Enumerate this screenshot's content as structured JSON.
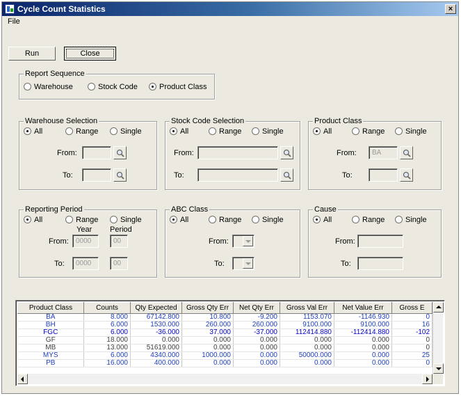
{
  "window": {
    "title": "Cycle Count Statistics",
    "close_glyph": "×"
  },
  "menu": {
    "file": "File"
  },
  "toolbar": {
    "run": "Run",
    "close": "Close"
  },
  "report_sequence": {
    "label": "Report Sequence",
    "options": [
      "Warehouse",
      "Stock Code",
      "Product Class"
    ],
    "selected": "Product Class"
  },
  "warehouse_selection": {
    "label": "Warehouse Selection",
    "options": [
      "All",
      "Range",
      "Single"
    ],
    "selected": "All",
    "from_label": "From:",
    "to_label": "To:",
    "from_value": "",
    "to_value": ""
  },
  "stock_code_selection": {
    "label": "Stock Code Selection",
    "options": [
      "All",
      "Range",
      "Single"
    ],
    "selected": "All",
    "from_label": "From:",
    "to_label": "To:",
    "from_value": "",
    "to_value": ""
  },
  "product_class": {
    "label": "Product Class",
    "options": [
      "All",
      "Range",
      "Single"
    ],
    "selected": "All",
    "from_label": "From:",
    "to_label": "To:",
    "from_value": "BA",
    "to_value": ""
  },
  "reporting_period": {
    "label": "Reporting Period",
    "options": [
      "All",
      "Range",
      "Single"
    ],
    "selected": "All",
    "year_label": "Year",
    "period_label": "Period",
    "from_label": "From:",
    "to_label": "To:",
    "from_year": "0000",
    "from_period": "00",
    "to_year": "0000",
    "to_period": "00"
  },
  "abc_class": {
    "label": "ABC Class",
    "options": [
      "All",
      "Range",
      "Single"
    ],
    "selected": "All",
    "from_label": "From:",
    "to_label": "To:"
  },
  "cause": {
    "label": "Cause",
    "options": [
      "All",
      "Range",
      "Single"
    ],
    "selected": "All",
    "from_label": "From:",
    "to_label": "To:",
    "from_value": "",
    "to_value": ""
  },
  "grid": {
    "columns": [
      "Product Class",
      "Counts",
      "Qty Expected",
      "Gross Qty Err",
      "Net Qty Err",
      "Gross Val Err",
      "Net Value Err",
      "Gross E"
    ],
    "rows": [
      [
        "BA",
        "8.000",
        "67142.800",
        "10.800",
        "-9.200",
        "1153.070",
        "-1146.930",
        "0"
      ],
      [
        "BH",
        "6.000",
        "1530.000",
        "260.000",
        "260.000",
        "9100.000",
        "9100.000",
        "16"
      ],
      [
        "FGC",
        "6.000",
        "-36.000",
        "37.000",
        "-37.000",
        "112414.880",
        "-112414.880",
        "-102"
      ],
      [
        "GF",
        "18.000",
        "0.000",
        "0.000",
        "0.000",
        "0.000",
        "0.000",
        "0"
      ],
      [
        "MB",
        "13.000",
        "51619.000",
        "0.000",
        "0.000",
        "0.000",
        "0.000",
        "0"
      ],
      [
        "MYS",
        "6.000",
        "4340.000",
        "1000.000",
        "0.000",
        "50000.000",
        "0.000",
        "25"
      ],
      [
        "PB",
        "16.000",
        "400.000",
        "0.000",
        "0.000",
        "0.000",
        "0.000",
        "0"
      ]
    ],
    "row_colors": [
      "#1f3fbf",
      "#1f3fbf",
      "#0000c8",
      "#404040",
      "#404040",
      "#1f3fbf",
      "#1f3fbf"
    ]
  },
  "colors": {
    "titlebar": "#0a246a",
    "dialog_bg": "#ece9e0",
    "grid_text_blue": "#1f3fbf"
  }
}
